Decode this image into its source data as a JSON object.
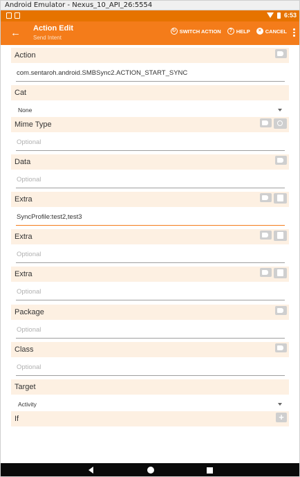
{
  "window": {
    "title": "Android Emulator - Nexus_10_API_26:5554"
  },
  "status_bar": {
    "time": "6:53"
  },
  "app_bar": {
    "title": "Action Edit",
    "subtitle": "Send Intent",
    "switch_action_label": "SWITCH ACTION",
    "help_label": "HELP",
    "cancel_label": "CANCEL"
  },
  "colors": {
    "accent": "#f47c1a",
    "status_bar": "#e67300",
    "section_bg": "#fdf0e2"
  },
  "fields": {
    "action": {
      "label": "Action",
      "value": "com.sentaroh.android.SMBSync2.ACTION_START_SYNC"
    },
    "cat": {
      "label": "Cat",
      "value": "None"
    },
    "mime_type": {
      "label": "Mime Type",
      "placeholder": "Optional"
    },
    "data": {
      "label": "Data",
      "placeholder": "Optional"
    },
    "extra1": {
      "label": "Extra",
      "value": "SyncProfile:test2,test3"
    },
    "extra2": {
      "label": "Extra",
      "placeholder": "Optional"
    },
    "extra3": {
      "label": "Extra",
      "placeholder": "Optional"
    },
    "package": {
      "label": "Package",
      "placeholder": "Optional"
    },
    "class": {
      "label": "Class",
      "placeholder": "Optional"
    },
    "target": {
      "label": "Target",
      "value": "Activity"
    },
    "if": {
      "label": "If"
    }
  },
  "icons": {
    "back": "arrow-back-icon",
    "switch_action": "refresh-icon",
    "help": "help-circle-icon",
    "cancel": "close-circle-icon",
    "overflow": "more-vert-icon",
    "tag": "label-icon",
    "search": "search-icon",
    "doc": "note-icon",
    "add": "plus-icon"
  }
}
